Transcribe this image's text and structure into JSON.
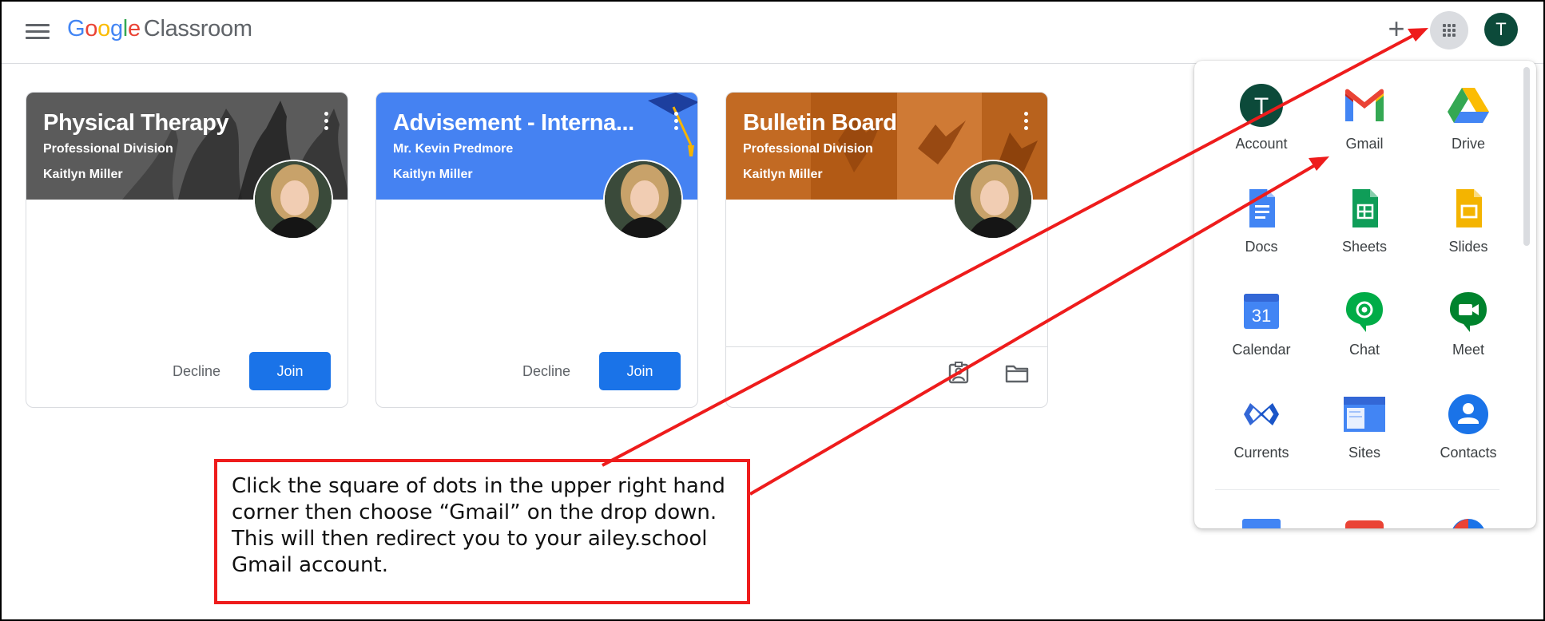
{
  "header": {
    "logo": {
      "g1": "G",
      "g2": "o",
      "g3": "o",
      "g4": "g",
      "g5": "l",
      "g6": "e",
      "product": "Classroom"
    },
    "add_label": "+",
    "avatar_initial": "T"
  },
  "cards": [
    {
      "title": "Physical Therapy",
      "subtitle": "Professional Division",
      "teacher": "Kaitlyn Miller",
      "banner_color": "#5a5a5a",
      "actions": {
        "decline": "Decline",
        "join": "Join"
      }
    },
    {
      "title": "Advisement - Interna...",
      "subtitle": "Mr. Kevin Predmore",
      "teacher": "Kaitlyn Miller",
      "banner_color": "#4285f4",
      "actions": {
        "decline": "Decline",
        "join": "Join"
      }
    },
    {
      "title": "Bulletin Board",
      "subtitle": "Professional Division",
      "teacher": "Kaitlyn Miller",
      "banner_color": "#c26a23",
      "icons": [
        "assignment-icon",
        "folder-icon"
      ]
    }
  ],
  "apps_panel": {
    "apps": [
      {
        "label": "Account",
        "icon": "account-icon"
      },
      {
        "label": "Gmail",
        "icon": "gmail-icon"
      },
      {
        "label": "Drive",
        "icon": "drive-icon"
      },
      {
        "label": "Docs",
        "icon": "docs-icon"
      },
      {
        "label": "Sheets",
        "icon": "sheets-icon"
      },
      {
        "label": "Slides",
        "icon": "slides-icon"
      },
      {
        "label": "Calendar",
        "icon": "calendar-icon"
      },
      {
        "label": "Chat",
        "icon": "chat-icon"
      },
      {
        "label": "Meet",
        "icon": "meet-icon"
      },
      {
        "label": "Currents",
        "icon": "currents-icon"
      },
      {
        "label": "Sites",
        "icon": "sites-icon"
      },
      {
        "label": "Contacts",
        "icon": "contacts-icon"
      }
    ],
    "account_initial": "T",
    "calendar_day": "31"
  },
  "annotation": {
    "text": "Click the square of dots in the upper right hand corner then choose “Gmail” on the drop down. This will then redirect you to your ailey.school Gmail account.",
    "color": "#ee1c1c"
  }
}
